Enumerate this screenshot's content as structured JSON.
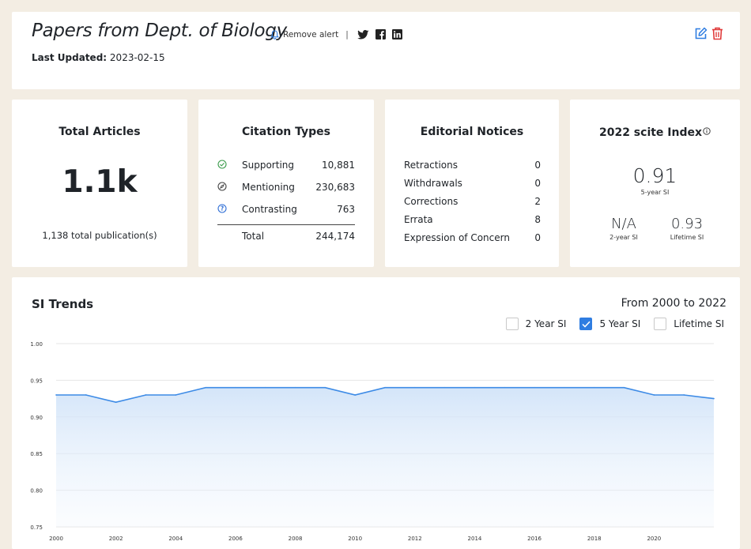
{
  "header": {
    "title": "Papers from Dept. of Biology",
    "remove_alert_label": "Remove alert",
    "separator": "|",
    "last_updated_label": "Last Updated:",
    "last_updated_value": "2023-02-15",
    "icons": [
      "bell-icon",
      "twitter-icon",
      "facebook-icon",
      "linkedin-icon",
      "edit-icon",
      "trash-icon"
    ]
  },
  "total_articles": {
    "title": "Total Articles",
    "value": "1.1k",
    "subtitle": "1,138 total publication(s)"
  },
  "citation_types": {
    "title": "Citation Types",
    "rows": [
      {
        "label": "Supporting",
        "value": "10,881",
        "icon": "check-circle-icon",
        "color": "#3a9b4b"
      },
      {
        "label": "Mentioning",
        "value": "230,683",
        "icon": "compass-circle-icon",
        "color": "#444444"
      },
      {
        "label": "Contrasting",
        "value": "763",
        "icon": "question-circle-icon",
        "color": "#2f6fd6"
      }
    ],
    "total_label": "Total",
    "total_value": "244,174"
  },
  "editorial_notices": {
    "title": "Editorial Notices",
    "rows": [
      {
        "label": "Retractions",
        "value": "0"
      },
      {
        "label": "Withdrawals",
        "value": "0"
      },
      {
        "label": "Corrections",
        "value": "2"
      },
      {
        "label": "Errata",
        "value": "8"
      },
      {
        "label": "Expression of Concern",
        "value": "0"
      }
    ]
  },
  "scite_index": {
    "title": "2022 scite Index",
    "five_year_value": "0.91",
    "five_year_label": "5-year SI",
    "two_year_value": "N/A",
    "two_year_label": "2-year SI",
    "lifetime_value": "0.93",
    "lifetime_label": "Lifetime SI"
  },
  "trends": {
    "title": "SI Trends",
    "range": "From 2000 to 2022",
    "legend": [
      {
        "label": "2 Year SI",
        "checked": false
      },
      {
        "label": "5 Year SI",
        "checked": true
      },
      {
        "label": "Lifetime SI",
        "checked": false
      }
    ]
  },
  "colors": {
    "accent": "#2f7de1",
    "line": "#3d8be6",
    "delete": "#e03a3a",
    "background": "#f3ede3"
  },
  "chart_data": {
    "type": "area",
    "x": [
      2000,
      2001,
      2002,
      2003,
      2004,
      2005,
      2006,
      2007,
      2008,
      2009,
      2010,
      2011,
      2012,
      2013,
      2014,
      2015,
      2016,
      2017,
      2018,
      2019,
      2020,
      2021,
      2022
    ],
    "series": [
      {
        "name": "5 Year SI",
        "values": [
          0.93,
          0.93,
          0.92,
          0.93,
          0.93,
          0.94,
          0.94,
          0.94,
          0.94,
          0.94,
          0.93,
          0.94,
          0.94,
          0.94,
          0.94,
          0.94,
          0.94,
          0.94,
          0.94,
          0.94,
          0.93,
          0.93,
          0.925
        ]
      }
    ],
    "xticks": [
      2000,
      2002,
      2004,
      2006,
      2008,
      2010,
      2012,
      2014,
      2016,
      2018,
      2020
    ],
    "yticks": [
      "1.00",
      "0.95",
      "0.90",
      "0.85",
      "0.80",
      "0.75"
    ],
    "ylim": [
      0.75,
      1.0
    ],
    "xlim": [
      2000,
      2022
    ],
    "grid": true
  }
}
